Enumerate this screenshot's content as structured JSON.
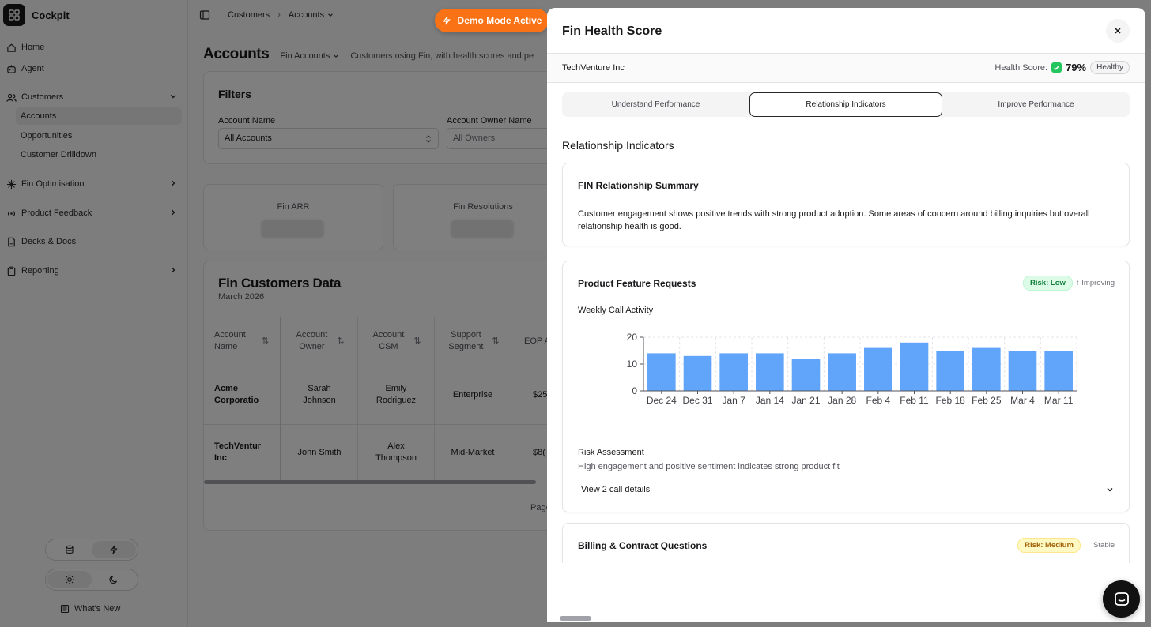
{
  "app": {
    "name": "Cockpit"
  },
  "sidebar": {
    "items": [
      {
        "label": "Home",
        "icon": "home-icon"
      },
      {
        "label": "Agent",
        "icon": "bot-icon"
      },
      {
        "label": "Customers",
        "icon": "users-icon",
        "expanded": true
      },
      {
        "label": "Fin Optimisation",
        "icon": "sparkle-icon"
      },
      {
        "label": "Product Feedback",
        "icon": "radio-icon"
      },
      {
        "label": "Decks & Docs",
        "icon": "document-icon"
      },
      {
        "label": "Reporting",
        "icon": "clipboard-icon"
      }
    ],
    "customers_sub": [
      "Accounts",
      "Opportunities",
      "Customer Drilldown"
    ],
    "active_sub": "Accounts",
    "footer": {
      "whats_new": "What's New"
    }
  },
  "topbar": {
    "breadcrumb": [
      "Customers",
      "Accounts"
    ]
  },
  "demo_badge": "Demo Mode Active",
  "page": {
    "title": "Accounts",
    "view": "Fin Accounts",
    "description": "Customers using Fin, with health scores and pe"
  },
  "filters": {
    "title": "Filters",
    "account_name_label": "Account Name",
    "account_name_value": "All Accounts",
    "owner_label": "Account Owner Name",
    "owner_value": "All Owners"
  },
  "stats": [
    {
      "label": "Fin ARR"
    },
    {
      "label": "Fin Resolutions"
    }
  ],
  "data_table": {
    "title": "Fin Customers Data",
    "subtitle": "March 2026",
    "columns": [
      "Account Name",
      "Account Owner",
      "Account CSM",
      "Support Segment",
      "EOP A"
    ],
    "rows": [
      [
        "Acme Corporatio",
        "Sarah Johnson",
        "Emily Rodriguez",
        "Enterprise",
        "$25"
      ],
      [
        "TechVentur Inc",
        "John Smith",
        "Alex Thompson",
        "Mid-Market",
        "$8("
      ]
    ],
    "pagination_text": "Page"
  },
  "modal": {
    "title": "Fin Health Score",
    "account": "TechVenture Inc",
    "health_label": "Health Score:",
    "health_value": "79%",
    "health_status": "Healthy",
    "tabs": [
      "Understand Performance",
      "Relationship Indicators",
      "Improve Performance"
    ],
    "active_tab": "Relationship Indicators",
    "section_title": "Relationship Indicators",
    "summary": {
      "title": "FIN Relationship Summary",
      "text": "Customer engagement shows positive trends with strong product adoption. Some areas of concern around billing inquiries but overall relationship health is good."
    },
    "feature_requests": {
      "title": "Product Feature Requests",
      "risk": "Risk: Low",
      "trend": "↑ Improving",
      "chart_label": "Weekly Call Activity",
      "risk_title": "Risk Assessment",
      "risk_desc": "High engagement and positive sentiment indicates strong product fit",
      "details": "View 2 call details"
    },
    "billing": {
      "title": "Billing & Contract Questions",
      "risk": "Risk: Medium",
      "trend": "→ Stable"
    }
  },
  "colors": {
    "accent": "#f97316",
    "bar": "#60a5fa",
    "risk_low": "#15803d",
    "risk_medium": "#a16207"
  },
  "chart_data": {
    "type": "bar",
    "title": "Weekly Call Activity",
    "categories": [
      "Dec 24",
      "Dec 31",
      "Jan 7",
      "Jan 14",
      "Jan 21",
      "Jan 28",
      "Feb 4",
      "Feb 11",
      "Feb 18",
      "Feb 25",
      "Mar 4",
      "Mar 11"
    ],
    "values": [
      14,
      13,
      14,
      14,
      12,
      14,
      16,
      18,
      15,
      16,
      15,
      15
    ],
    "ylim": [
      0,
      20
    ],
    "yticks": [
      0,
      10,
      20
    ],
    "grid": true
  }
}
